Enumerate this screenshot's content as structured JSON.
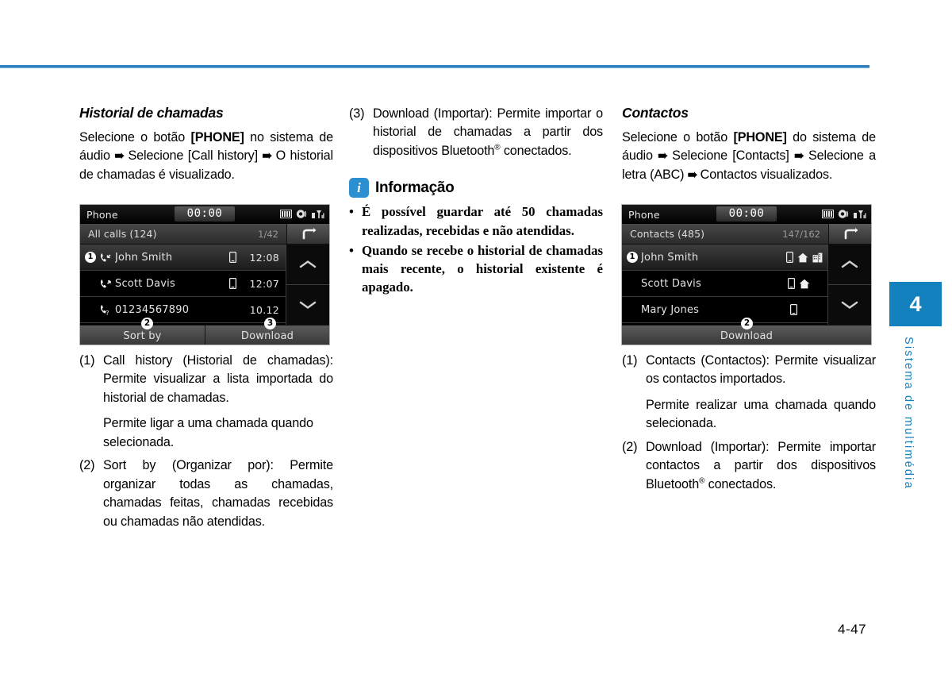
{
  "page": {
    "number": "4-47",
    "chapter_tab": "4",
    "chapter_label": "Sistema de multimédia",
    "accent_color": "#1481bf"
  },
  "left_column": {
    "title": "Historial de chamadas",
    "intro_parts": {
      "p1": "Selecione o botão ",
      "phone_button": "[PHONE]",
      "p2": " no sistema de áudio ",
      "arrow1": "➠",
      "p3": " Selecione [Call history] ",
      "arrow2": "➠",
      "p4": " O historial de chamadas é visualizado."
    },
    "items": [
      {
        "marker": "(1)",
        "text": "Call history (Historial de chamadas): Permite visualizar a lista importada do historial de chamadas.",
        "sub": "Permite ligar a uma chamada quando selecionada."
      },
      {
        "marker": "(2)",
        "text": "Sort by (Organizar por): Permite organizar todas as chamadas, chamadas feitas, chamadas recebidas ou chamadas não atendidas."
      }
    ]
  },
  "middle_column": {
    "items": [
      {
        "marker": "(3)",
        "text_a": "Download (Importar): Permite importar o historial de chamadas a partir dos dispositivos Bluetooth",
        "sup": "®",
        "text_b": " conectados."
      }
    ],
    "info": {
      "icon": "info-icon",
      "icon_glyph": "i",
      "title": "Informação",
      "bullets": [
        "É possível guardar até 50 chamadas realizadas, recebidas e não atendidas.",
        "Quando se recebe o historial de chamadas mais recente, o historial existente é apagado."
      ]
    }
  },
  "right_column": {
    "title": "Contactos",
    "intro_parts": {
      "p1": "Selecione o botão ",
      "phone_button": "[PHONE]",
      "p2": " do sistema de áudio ",
      "arrow1": "➠",
      "p3": " Selecione [Contacts] ",
      "arrow2": "➠",
      "p4": " Selecione a letra (ABC) ",
      "arrow3": "➠",
      "p5": " Contactos visualizados."
    },
    "items": [
      {
        "marker": "(1)",
        "text": "Contacts (Contactos): Permite visualizar os contactos importados.",
        "sub": "Permite realizar uma chamada quando selecionada."
      },
      {
        "marker": "(2)",
        "text_a": "Download (Importar): Permite importar contactos a partir dos dispositivos Bluetooth",
        "sup": "®",
        "text_b": " conectados."
      }
    ]
  },
  "device_call_history": {
    "status": {
      "title": "Phone",
      "clock": "00:00",
      "icons": [
        "sim-card-icon",
        "headset-audio-icon",
        "signal-strength-icon"
      ]
    },
    "header": {
      "title": "All calls (124)",
      "count": "1/42",
      "back_icon": "back-arrow-icon"
    },
    "rows": [
      {
        "badge": "❶",
        "call_icon": "incoming-call-icon",
        "name": "John Smith",
        "device_icon": "mobile-phone-icon",
        "time": "12:08",
        "selected": true
      },
      {
        "badge": "",
        "call_icon": "outgoing-call-icon",
        "name": "Scott Davis",
        "device_icon": "mobile-phone-icon",
        "time": "12:07",
        "selected": false
      },
      {
        "badge": "",
        "call_icon": "missed-call-icon",
        "name": "01234567890",
        "device_icon": "",
        "time": "10.12",
        "selected": false
      }
    ],
    "scroll": {
      "up_icon": "chevron-up-icon",
      "down_icon": "chevron-down-icon"
    },
    "footer": [
      {
        "label": "Sort by",
        "callout": "❷"
      },
      {
        "label": "Download",
        "callout": "❸"
      }
    ]
  },
  "device_contacts": {
    "status": {
      "title": "Phone",
      "clock": "00:00",
      "icons": [
        "sim-card-icon",
        "headset-audio-icon",
        "signal-strength-icon"
      ]
    },
    "header": {
      "title": "Contacts (485)",
      "count": "147/162",
      "back_icon": "back-arrow-icon"
    },
    "rows": [
      {
        "badge": "❶",
        "name": "John Smith",
        "icons": [
          "mobile-phone-icon",
          "home-icon",
          "office-icon"
        ],
        "selected": true
      },
      {
        "badge": "",
        "name": "Scott Davis",
        "icons": [
          "mobile-phone-icon",
          "home-icon"
        ],
        "selected": false
      },
      {
        "badge": "",
        "name": "Mary Jones",
        "icons": [
          "mobile-phone-icon"
        ],
        "selected": false
      }
    ],
    "scroll": {
      "up_icon": "chevron-up-icon",
      "down_icon": "chevron-down-icon"
    },
    "footer": [
      {
        "label": "Download",
        "callout": "❷"
      }
    ]
  }
}
